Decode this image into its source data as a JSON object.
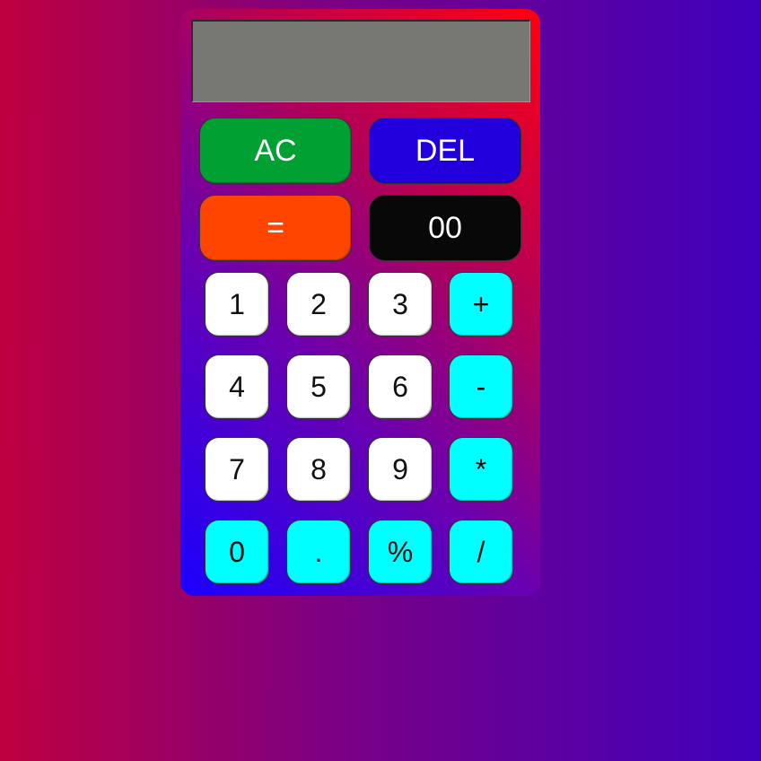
{
  "display": {
    "value": ""
  },
  "function_buttons": [
    {
      "label": "AC",
      "color": "#00a032"
    },
    {
      "label": "DEL",
      "color": "#2200dd"
    },
    {
      "label": "=",
      "color": "#ff4500"
    },
    {
      "label": "00",
      "color": "#080808"
    }
  ],
  "keypad": {
    "rows": [
      [
        {
          "label": "1"
        },
        {
          "label": "2"
        },
        {
          "label": "3"
        },
        {
          "label": "+"
        }
      ],
      [
        {
          "label": "4"
        },
        {
          "label": "5"
        },
        {
          "label": "6"
        },
        {
          "label": "-"
        }
      ],
      [
        {
          "label": "7"
        },
        {
          "label": "8"
        },
        {
          "label": "9"
        },
        {
          "label": "*"
        }
      ],
      [
        {
          "label": "0"
        },
        {
          "label": "."
        },
        {
          "label": "%"
        },
        {
          "label": "/"
        }
      ]
    ]
  },
  "colors": {
    "digit_key": "#ffffff",
    "operator_key": "#00ffff",
    "display_bg": "#777774"
  }
}
